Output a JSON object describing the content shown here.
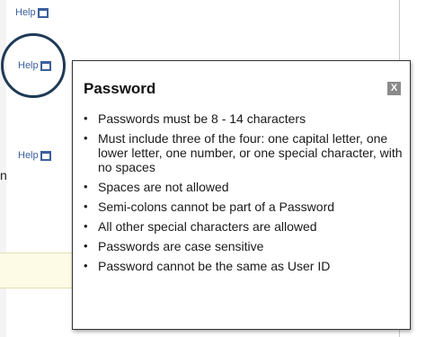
{
  "help_links": [
    {
      "label": "Help"
    },
    {
      "label": "Help"
    },
    {
      "label": "Help"
    }
  ],
  "edge_text": "n",
  "popup": {
    "title": "Password",
    "close_label": "X",
    "rules": [
      "Passwords must be 8 - 14 characters",
      "Must include three of the four: one capital letter, one lower letter, one number, or one special character, with no spaces",
      "Spaces are not allowed",
      "Semi-colons cannot be part of a Password",
      "All other special characters are allowed",
      "Passwords are case sensitive",
      "Password cannot be the same as User ID"
    ]
  },
  "colors": {
    "link": "#3b5f9c",
    "highlight_circle": "#1f3a56",
    "close_button": "#8a8a8a",
    "yellow_strip": "#fdfbe6"
  }
}
